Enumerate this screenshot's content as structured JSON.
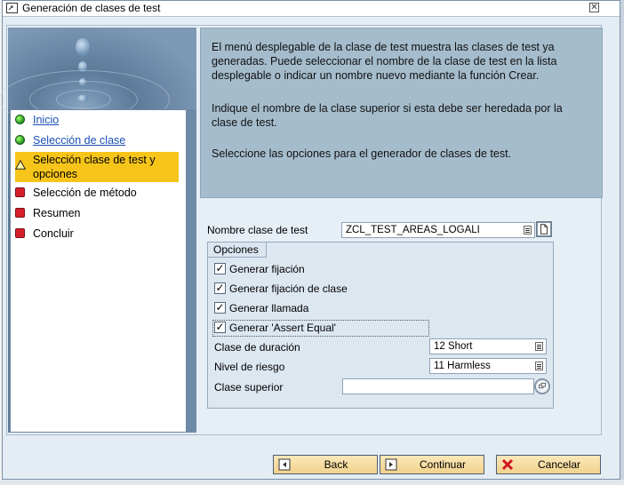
{
  "window": {
    "title": "Generación de clases de test"
  },
  "nav": {
    "items": [
      {
        "label": "Inicio",
        "status": "done"
      },
      {
        "label": "Selección de clase",
        "status": "done"
      },
      {
        "label": "Selección clase de test y opciones",
        "status": "current"
      },
      {
        "label": "Selección de método",
        "status": "pending"
      },
      {
        "label": "Resumen",
        "status": "pending"
      },
      {
        "label": "Concluir",
        "status": "pending"
      }
    ]
  },
  "info": {
    "p1": "El menú desplegable de la clase de test muestra las clases de test ya generadas. Puede seleccionar el nombre de la clase de test en la lista desplegable o indicar un nombre nuevo mediante la función Crear.",
    "p2": "Indique el nombre de la clase superior si esta debe ser heredada por la clase de test.",
    "p3": "Seleccione las opciones para el generador de clases de test."
  },
  "form": {
    "test_class_label": "Nombre clase de test",
    "test_class_value": "ZCL_TEST_AREAS_LOGALI",
    "options_title": "Opciones",
    "checkboxes": [
      {
        "label": "Generar fijación",
        "checked": true
      },
      {
        "label": "Generar fijación de clase",
        "checked": true
      },
      {
        "label": "Generar llamada",
        "checked": true
      },
      {
        "label": "Generar 'Assert Equal'",
        "checked": true
      }
    ],
    "duration_label": "Clase de duración",
    "duration_value": "12 Short",
    "risk_label": "Nivel de riesgo",
    "risk_value": "11 Harmless",
    "superclass_label": "Clase superior",
    "superclass_value": ""
  },
  "buttons": {
    "back": "Back",
    "continue": "Continuar",
    "cancel": "Cancelar"
  },
  "colors": {
    "active_step": "#f7c51a",
    "info_panel": "#a5bccc",
    "link": "#1a4fb5"
  }
}
